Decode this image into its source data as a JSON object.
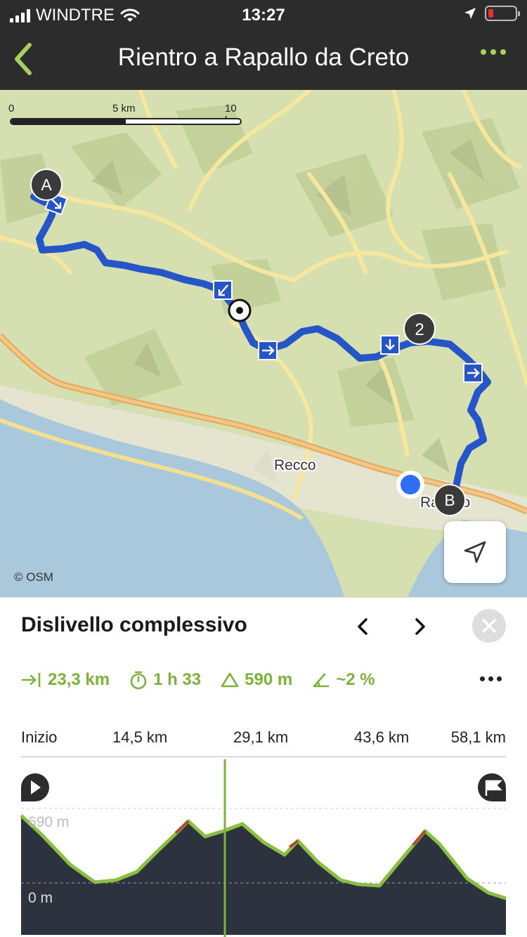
{
  "status": {
    "carrier": "WINDTRE",
    "time": "13:27"
  },
  "header": {
    "title": "Rientro a Rapallo da Creto"
  },
  "map": {
    "scale_labels": [
      "0",
      "5 km",
      "10 km"
    ],
    "place_labels": [
      "Recco",
      "Rapallo"
    ],
    "markers": [
      "A",
      "2",
      "B"
    ],
    "attribution": "© OSM"
  },
  "sheet": {
    "title": "Dislivello complessivo",
    "stats": {
      "distance": "23,3 km",
      "duration": "1 h 33",
      "ascent": "590 m",
      "gradient": "~2 %"
    },
    "profile": {
      "tick_labels": [
        "Inizio",
        "14,5 km",
        "29,1 km",
        "43,6 km",
        "58,1 km"
      ],
      "elevation_labels": [
        "690 m",
        "0 m"
      ]
    }
  },
  "colors": {
    "header_bg": "#2c2c2c",
    "accent_green": "#7eb13b",
    "route_blue": "#2555c7",
    "profile_fill": "#2d323f",
    "sea": "#a9c8dc"
  }
}
